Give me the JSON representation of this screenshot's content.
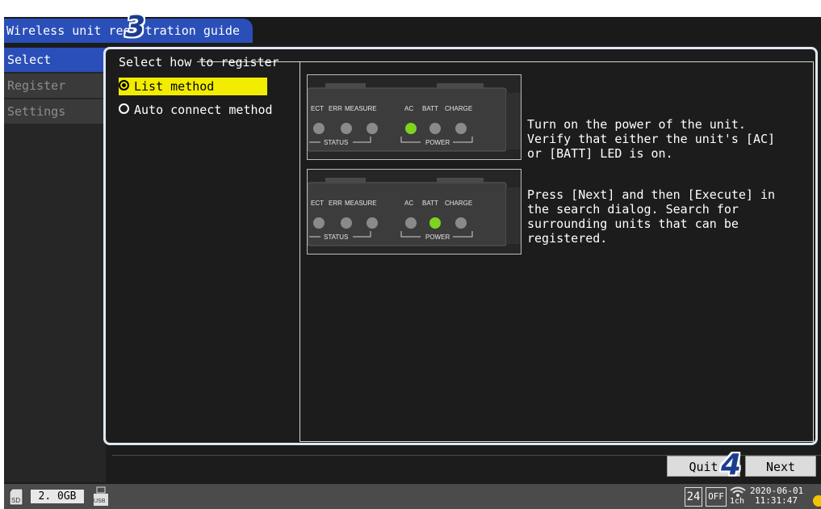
{
  "window": {
    "title": "Wireless unit registration guide"
  },
  "sidebar": {
    "items": [
      {
        "label": "Select",
        "active": true
      },
      {
        "label": "Register",
        "active": false
      },
      {
        "label": "Settings",
        "active": false
      }
    ]
  },
  "select_group": {
    "legend": "Select how to register",
    "options": [
      {
        "label": "List method",
        "selected": true
      },
      {
        "label": "Auto connect method",
        "selected": false
      }
    ]
  },
  "steps": [
    {
      "panel": {
        "labels": [
          "ECT",
          "ERR",
          "MEASURE",
          "AC",
          "BATT",
          "CHARGE"
        ],
        "status_label": "STATUS",
        "power_label": "POWER",
        "lit_led": "AC"
      },
      "text": "Turn on the power of the unit.\nVerify that either the unit's [AC]\nor [BATT] LED is on."
    },
    {
      "panel": {
        "labels": [
          "ECT",
          "ERR",
          "MEASURE",
          "AC",
          "BATT",
          "CHARGE"
        ],
        "status_label": "STATUS",
        "power_label": "POWER",
        "lit_led": "BATT"
      },
      "text": "Press [Next] and then [Execute] in\nthe search dialog. Search for\nsurrounding units that can be\nregistered."
    }
  ],
  "buttons": {
    "quit": "Quit",
    "next": "Next"
  },
  "status_bar": {
    "sd_icon": "SD",
    "capacity": "2. 0GB",
    "usb_icon": "USB",
    "temp_badge": "24",
    "off_badge": "OFF",
    "wifi_icon": "wifi-icon",
    "channel": "1ch",
    "date": "2020-06-01",
    "time": "11:31:47"
  },
  "callouts": {
    "step3": "3",
    "step4": "4"
  },
  "colors": {
    "accent_blue": "#2a4fb8",
    "highlight_yellow": "#f2ec00",
    "led_green": "#7ed321",
    "callout_blue": "#1b3d8f"
  }
}
